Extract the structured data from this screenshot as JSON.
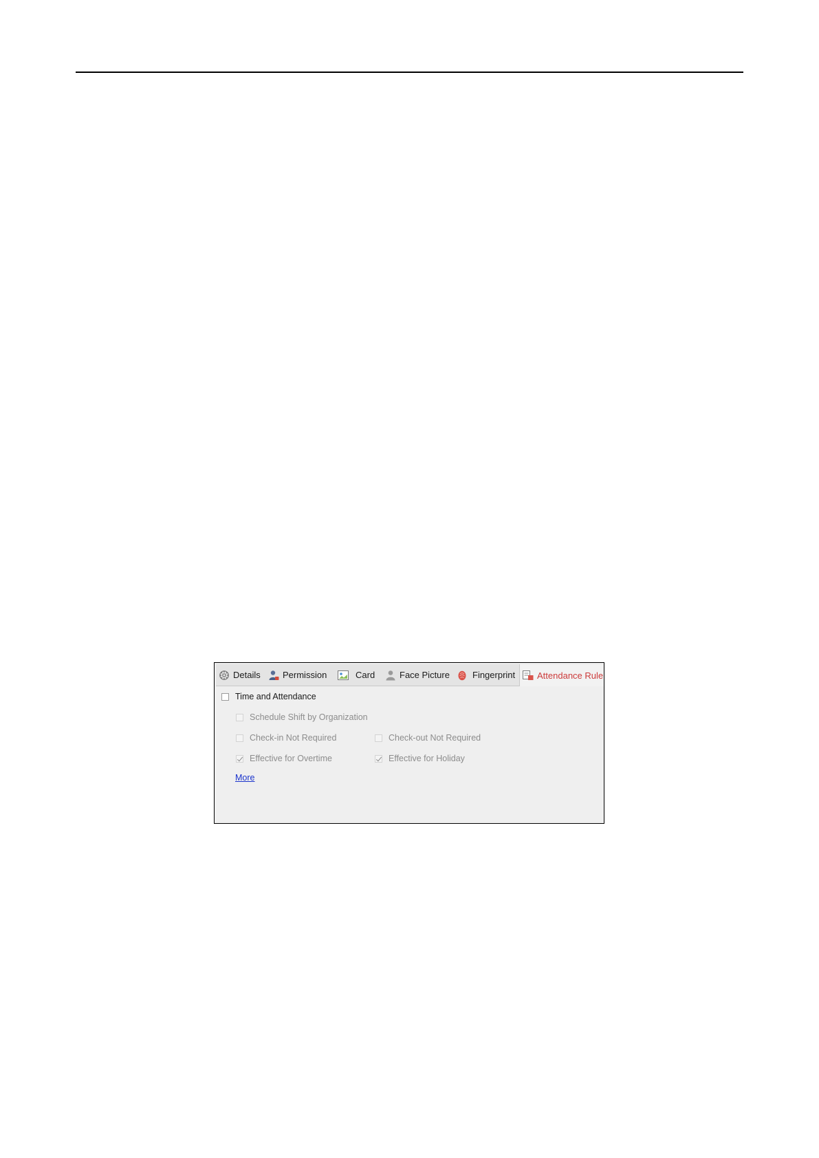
{
  "tabs": [
    {
      "label": "Details",
      "icon": "gear-icon",
      "active": false
    },
    {
      "label": "Permission",
      "icon": "user-permission-icon",
      "active": false
    },
    {
      "label": "Card",
      "icon": "card-icon",
      "active": false
    },
    {
      "label": "Face Picture",
      "icon": "person-icon",
      "active": false
    },
    {
      "label": "Fingerprint",
      "icon": "fingerprint-icon",
      "active": false
    },
    {
      "label": "Attendance Rule",
      "icon": "attendance-rule-icon",
      "active": true
    }
  ],
  "options": {
    "time_and_attendance": {
      "label": "Time and Attendance",
      "checked": false,
      "enabled": true
    },
    "schedule_shift": {
      "label": "Schedule Shift by Organization",
      "checked": false,
      "enabled": false
    },
    "checkin_not_required": {
      "label": "Check-in Not Required",
      "checked": false,
      "enabled": false
    },
    "checkout_not_required": {
      "label": "Check-out Not Required",
      "checked": false,
      "enabled": false
    },
    "effective_overtime": {
      "label": "Effective for Overtime",
      "checked": true,
      "enabled": false
    },
    "effective_holiday": {
      "label": "Effective for Holiday",
      "checked": true,
      "enabled": false
    }
  },
  "more_link": "More",
  "colors": {
    "active_tab_text": "#cc3a3a",
    "link": "#1a33cc",
    "panel_bg": "#efefef"
  }
}
